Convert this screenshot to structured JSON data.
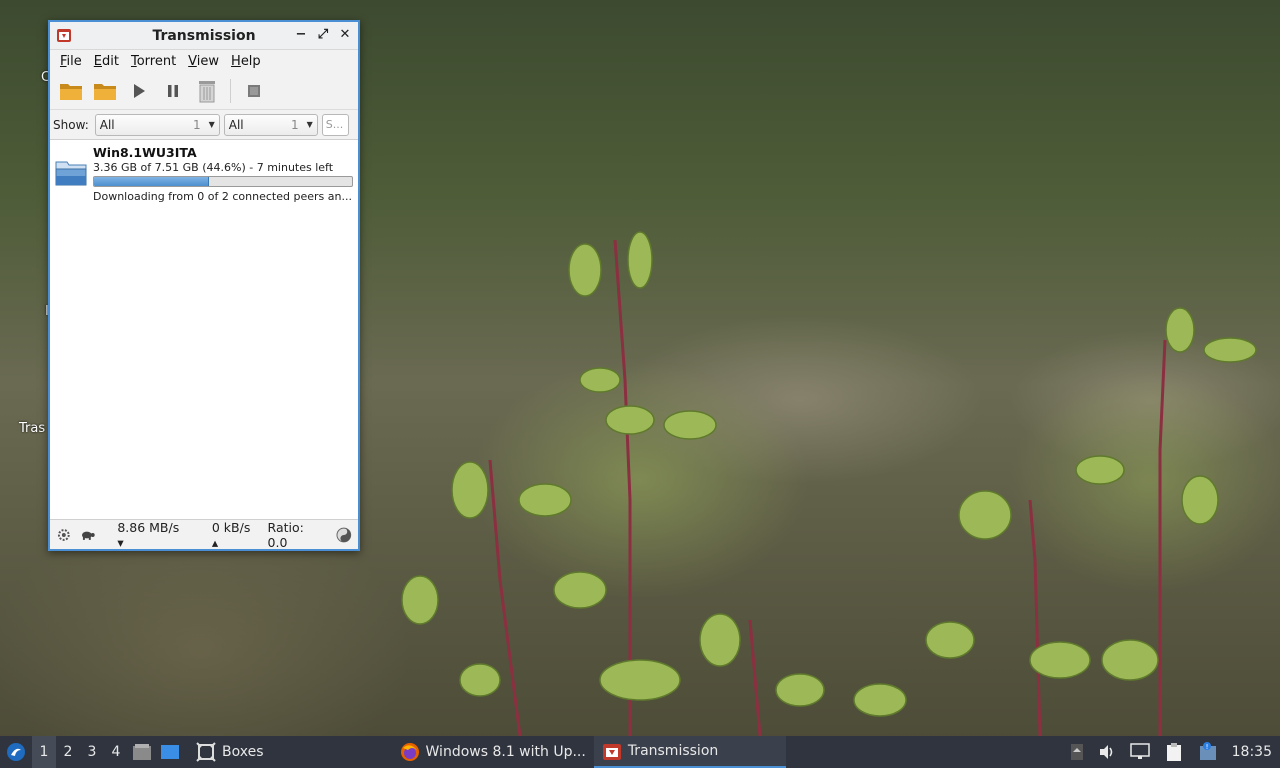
{
  "desktop": {
    "labels": [
      "C",
      "I",
      "Tras"
    ]
  },
  "window": {
    "title": "Transmission",
    "controls": {
      "minimize": "−",
      "maximize": "⤢",
      "close": "✕"
    }
  },
  "menu": {
    "items": [
      {
        "ul": "F",
        "rest": "ile"
      },
      {
        "ul": "E",
        "rest": "dit"
      },
      {
        "ul": "T",
        "rest": "orrent"
      },
      {
        "ul": "V",
        "rest": "iew"
      },
      {
        "ul": "H",
        "rest": "elp"
      }
    ]
  },
  "toolbar": {
    "icons": [
      "open-folder-icon",
      "open-url-folder-icon",
      "start-icon",
      "pause-icon",
      "remove-icon",
      "properties-icon"
    ]
  },
  "filter": {
    "show_label": "Show:",
    "activity": {
      "value": "All",
      "count": "1"
    },
    "tracker": {
      "value": "All",
      "count": "1"
    },
    "search_placeholder": "S..."
  },
  "torrents": [
    {
      "name": "Win8.1WU3ITA",
      "progress_text": "3.36 GB of 7.51 GB (44.6%) - 7 minutes left",
      "progress": 0.446,
      "status": "Downloading from 0 of 2 connected peers an..."
    }
  ],
  "statusbar": {
    "download_speed": "8.86 MB/s ▾",
    "upload_speed": "0 kB/s ▴",
    "ratio": "Ratio: 0.0"
  },
  "taskbar": {
    "workspaces": [
      "1",
      "2",
      "3",
      "4"
    ],
    "active_workspace": "1",
    "tasks": [
      {
        "label": "Boxes",
        "icon": "boxes-icon"
      },
      {
        "label": "Windows 8.1 with Up...",
        "icon": "firefox-icon"
      },
      {
        "label": "Transmission",
        "icon": "transmission-icon"
      }
    ],
    "clock": "18:35"
  },
  "colors": {
    "accent": "#4a8fd3",
    "taskbar_bg": "#2f343f",
    "progress_fill": "#4d8fcf"
  }
}
